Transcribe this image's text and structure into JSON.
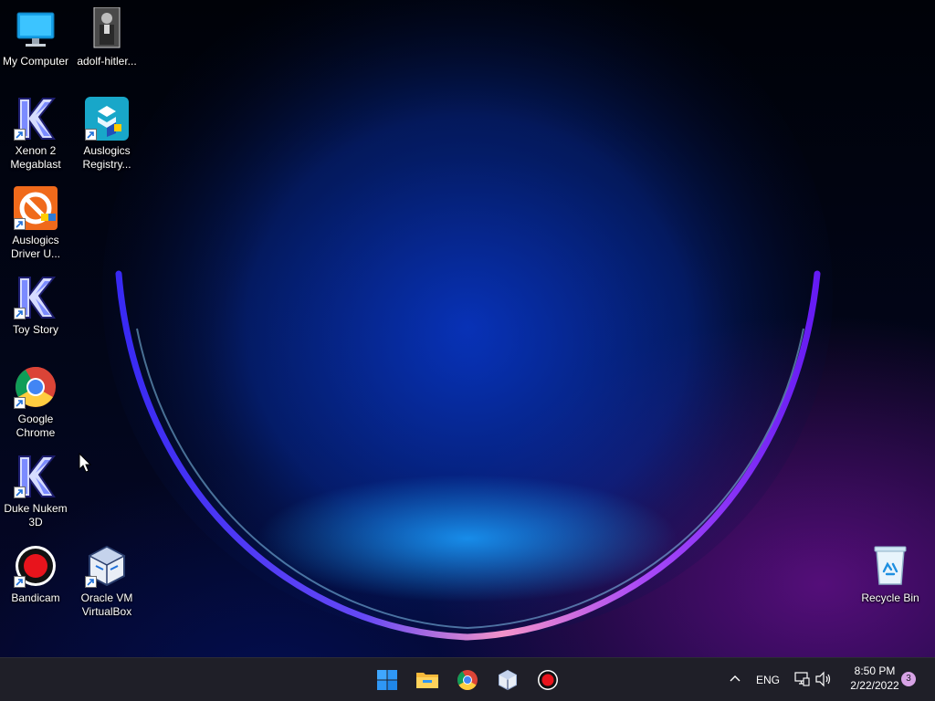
{
  "desktop": {
    "icons": [
      {
        "id": "my-computer",
        "label": "My Computer",
        "icon": "monitor-icon"
      },
      {
        "id": "adolf-hitler",
        "label": "adolf-hitler...",
        "icon": "photo-thumbnail-icon"
      },
      {
        "id": "xenon",
        "label": "Xenon 2 Megablast",
        "icon": "k-letter-icon"
      },
      {
        "id": "auslogics-registry",
        "label": "Auslogics Registry...",
        "icon": "registry-cleaner-icon"
      },
      {
        "id": "auslogics-driver",
        "label": "Auslogics Driver U...",
        "icon": "driver-updater-icon"
      },
      {
        "id": "toy-story",
        "label": "Toy Story",
        "icon": "k-letter-icon"
      },
      {
        "id": "chrome",
        "label": "Google Chrome",
        "icon": "chrome-icon"
      },
      {
        "id": "duke-nukem",
        "label": "Duke Nukem 3D",
        "icon": "k-letter-icon"
      },
      {
        "id": "bandicam",
        "label": "Bandicam",
        "icon": "record-icon"
      },
      {
        "id": "virtualbox",
        "label": "Oracle VM VirtualBox",
        "icon": "virtualbox-icon"
      },
      {
        "id": "recycle-bin",
        "label": "Recycle Bin",
        "icon": "recycle-bin-icon"
      }
    ]
  },
  "taskbar": {
    "pinned": [
      {
        "name": "start-button",
        "icon": "windows-logo-icon"
      },
      {
        "name": "file-explorer-button",
        "icon": "folder-icon"
      },
      {
        "name": "chrome-taskbar-button",
        "icon": "chrome-icon"
      },
      {
        "name": "virtualbox-taskbar-button",
        "icon": "virtualbox-icon"
      },
      {
        "name": "bandicam-taskbar-button",
        "icon": "record-icon"
      }
    ],
    "tray": {
      "overflow_icon": "chevron-up-icon",
      "language": "ENG",
      "network_icon": "network-icon",
      "volume_icon": "volume-icon",
      "time": "8:50 PM",
      "date": "2/22/2022",
      "notification_count": "3"
    }
  },
  "colors": {
    "taskbar_bg": "#1f1f28",
    "accent_blue": "#1e90ff",
    "bandicam_red": "#e8141c",
    "badge": "#d7a3e6"
  }
}
